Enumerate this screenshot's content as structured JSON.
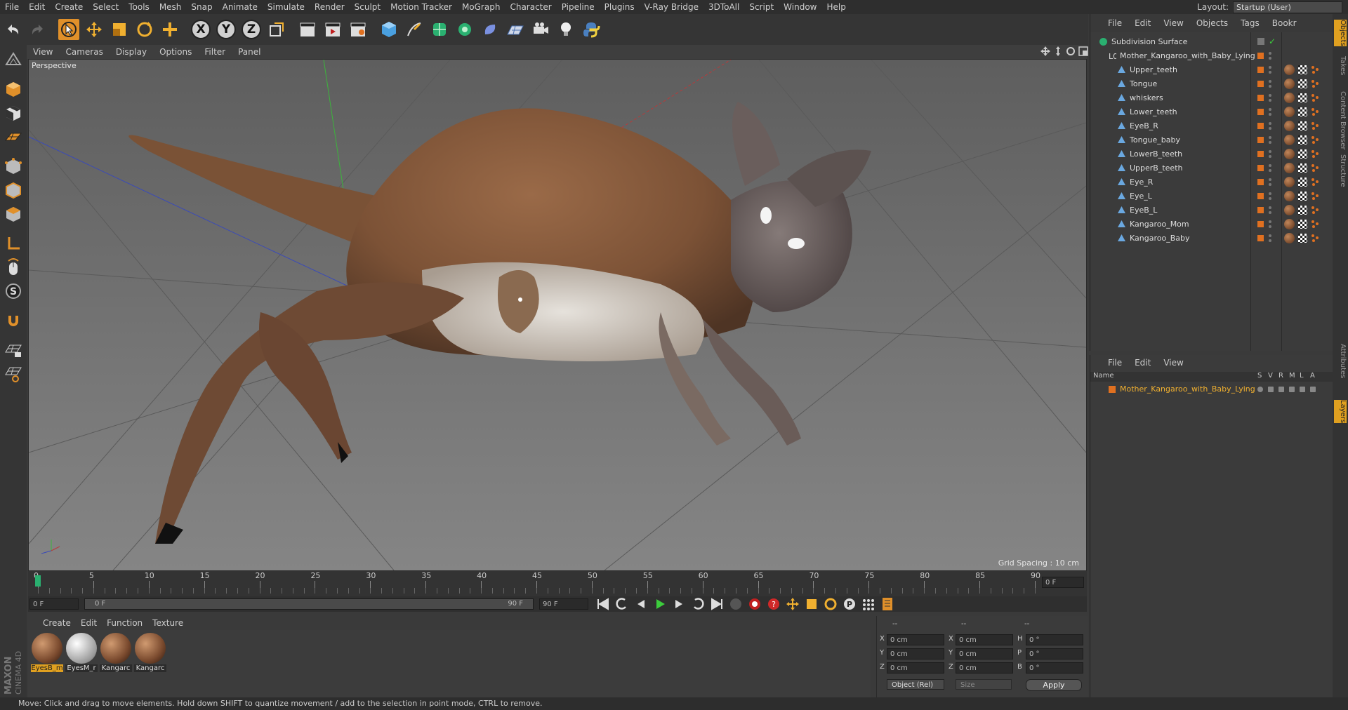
{
  "menu": [
    "File",
    "Edit",
    "Create",
    "Select",
    "Tools",
    "Mesh",
    "Snap",
    "Animate",
    "Simulate",
    "Render",
    "Sculpt",
    "Motion Tracker",
    "MoGraph",
    "Character",
    "Pipeline",
    "Plugins",
    "V-Ray Bridge",
    "3DToAll",
    "Script",
    "Window",
    "Help"
  ],
  "layout": {
    "label": "Layout:",
    "value": "Startup (User)"
  },
  "axis_buttons": {
    "x": "X",
    "y": "Y",
    "z": "Z"
  },
  "viewport_menu": [
    "View",
    "Cameras",
    "Display",
    "Options",
    "Filter",
    "Panel"
  ],
  "viewport": {
    "label": "Perspective",
    "grid_spacing": "Grid Spacing : 10 cm"
  },
  "timeline": {
    "ticks": [
      "0",
      "5",
      "10",
      "15",
      "20",
      "25",
      "30",
      "35",
      "40",
      "45",
      "50",
      "55",
      "60",
      "65",
      "70",
      "75",
      "80",
      "85",
      "90"
    ],
    "current_frame": "0 F",
    "start_field": "0 F",
    "range_start": "0 F",
    "range_end": "90 F",
    "end_field": "90 F"
  },
  "material_menu": [
    "Create",
    "Edit",
    "Function",
    "Texture"
  ],
  "materials": [
    {
      "name": "EyesB_m",
      "color": "#7a4a2e",
      "selected": true
    },
    {
      "name": "EyesM_r",
      "color": "#d8d8d8",
      "selected": false
    },
    {
      "name": "Kangarc",
      "color": "#7a4a2e",
      "selected": false
    },
    {
      "name": "Kangarc",
      "color": "#7a4a2e",
      "selected": false
    }
  ],
  "coords": {
    "header_dashes": [
      "--",
      "--",
      "--"
    ],
    "rows": [
      {
        "a": "X",
        "av": "0 cm",
        "b": "X",
        "bv": "0 cm",
        "c": "H",
        "cv": "0 °"
      },
      {
        "a": "Y",
        "av": "0 cm",
        "b": "Y",
        "bv": "0 cm",
        "c": "P",
        "cv": "0 °"
      },
      {
        "a": "Z",
        "av": "0 cm",
        "b": "Z",
        "bv": "0 cm",
        "c": "B",
        "cv": "0 °"
      }
    ],
    "mode": "Object (Rel)",
    "size": "Size",
    "apply": "Apply"
  },
  "status": "Move: Click and drag to move elements. Hold down SHIFT to quantize movement / add to the selection in point mode, CTRL to remove.",
  "object_menu": [
    "File",
    "Edit",
    "View",
    "Objects",
    "Tags",
    "Bookr"
  ],
  "objects": [
    {
      "name": "Subdivision Surface",
      "level": 0,
      "type": "subdiv"
    },
    {
      "name": "Mother_Kangaroo_with_Baby_Lying",
      "level": 1,
      "type": "null"
    },
    {
      "name": "Upper_teeth",
      "level": 2,
      "type": "mesh"
    },
    {
      "name": "Tongue",
      "level": 2,
      "type": "mesh"
    },
    {
      "name": "whiskers",
      "level": 2,
      "type": "mesh"
    },
    {
      "name": "Lower_teeth",
      "level": 2,
      "type": "mesh"
    },
    {
      "name": "EyeB_R",
      "level": 2,
      "type": "mesh"
    },
    {
      "name": "Tongue_baby",
      "level": 2,
      "type": "mesh"
    },
    {
      "name": "LowerB_teeth",
      "level": 2,
      "type": "mesh"
    },
    {
      "name": "UpperB_teeth",
      "level": 2,
      "type": "mesh"
    },
    {
      "name": "Eye_R",
      "level": 2,
      "type": "mesh"
    },
    {
      "name": "Eye_L",
      "level": 2,
      "type": "mesh"
    },
    {
      "name": "EyeB_L",
      "level": 2,
      "type": "mesh"
    },
    {
      "name": "Kangaroo_Mom",
      "level": 2,
      "type": "mesh"
    },
    {
      "name": "Kangaroo_Baby",
      "level": 2,
      "type": "mesh"
    }
  ],
  "layer_menu": [
    "File",
    "Edit",
    "View"
  ],
  "layer_columns": {
    "name": "Name",
    "flags": [
      "S",
      "V",
      "R",
      "M",
      "L",
      "A"
    ]
  },
  "layers": [
    {
      "name": "Mother_Kangaroo_with_Baby_Lying",
      "color": "#e07020"
    }
  ],
  "side_tabs": [
    "Objects",
    "Takes",
    "Content Browser",
    "Structure",
    "Attributes",
    "Layers"
  ],
  "brand": "MAXON CINEMA 4D",
  "colors": {
    "accent": "#e0a020",
    "layer": "#e07020",
    "selected_text": "#f0b030"
  }
}
